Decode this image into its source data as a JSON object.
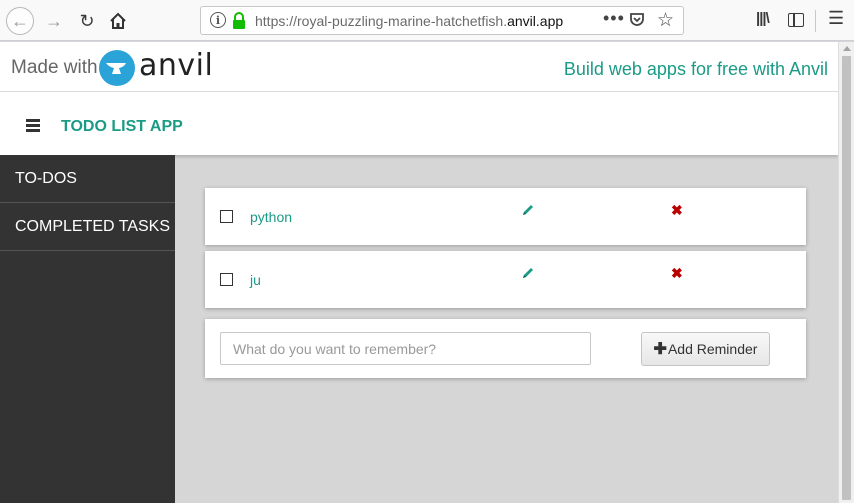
{
  "browser": {
    "url_prefix": "https://royal-puzzling-marine-hatchetfish.",
    "url_domain": "anvil.app",
    "url_dots": "•••"
  },
  "banner": {
    "made_with": "Made with",
    "brand": "anvil",
    "tagline": "Build web apps for free with Anvil"
  },
  "header": {
    "title": "TODO LIST APP"
  },
  "sidebar": {
    "items": [
      {
        "label": "TO-DOS"
      },
      {
        "label": "COMPLETED TASKS"
      }
    ]
  },
  "todos": [
    {
      "text": "python",
      "checked": false
    },
    {
      "text": "ju",
      "checked": false
    }
  ],
  "reminder": {
    "placeholder": "What do you want to remember?",
    "value": "",
    "add_label": "Add Reminder"
  },
  "colors": {
    "accent": "#1b9b86",
    "sidebar_bg": "#333333",
    "delete": "#bb0000",
    "anvil_blue": "#2aa3d9"
  }
}
